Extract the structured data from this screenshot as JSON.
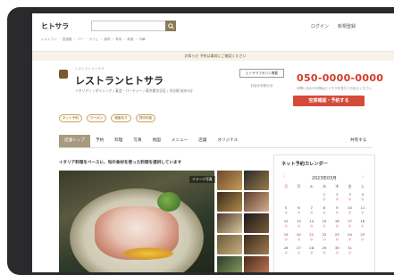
{
  "header": {
    "logo": "ヒトサラ",
    "search_placeholder": "",
    "links": [
      "ログイン",
      "新規登録"
    ]
  },
  "categories_line": "レストラン ・ 居酒屋 ・ バー ・ カフェ ・ 焼肉 ・ 寿司 ・ 和食 ・ 中華",
  "notice": "お知らせ 予約は事前にご確認ください",
  "restaurant": {
    "kana": "レストラン ヒトサラ",
    "name": "レストランヒトサラ",
    "meta": "イタリアン / ダイニング / 宴会・パーティー / 東京都渋谷区 / 渋谷駅 徒歩5分",
    "tag_buttons": [
      "ヒトサラマガジン掲載",
      "お店のお知らせ"
    ],
    "tel": "050-0000-0000",
    "tel_note": "お問い合わせの際はヒトサラを見たとお伝えください",
    "reserve_label": "空席確認・予約する"
  },
  "badges": [
    "ネット予約",
    "クーポン",
    "個室あり",
    "貸切可能"
  ],
  "tabs": [
    "店舗トップ",
    "予約",
    "料理",
    "写真",
    "地図",
    "メニュー",
    "店舗",
    "オリジナル"
  ],
  "share_label": "共有する",
  "headline": "イタリア料理をベースに、旬の食材を使った料理を提供しています",
  "image_tag": "イメージ写真",
  "calendar": {
    "title": "ネット予約カレンダー",
    "month": "2023年03月",
    "weekdays": [
      "日",
      "月",
      "火",
      "水",
      "木",
      "金",
      "土"
    ],
    "days": [
      "",
      "",
      "",
      "1",
      "2",
      "3",
      "4",
      "5",
      "6",
      "7",
      "8",
      "9",
      "10",
      "11",
      "12",
      "13",
      "14",
      "15",
      "16",
      "17",
      "18",
      "19",
      "20",
      "21",
      "22",
      "23",
      "24",
      "25",
      "26",
      "27",
      "28",
      "29",
      "30",
      "31",
      ""
    ],
    "mark": "◎"
  },
  "colors": {
    "accent_red": "#d64a3a",
    "tab_active": "#a89a7e",
    "notice_bg": "#f7f3e8"
  }
}
